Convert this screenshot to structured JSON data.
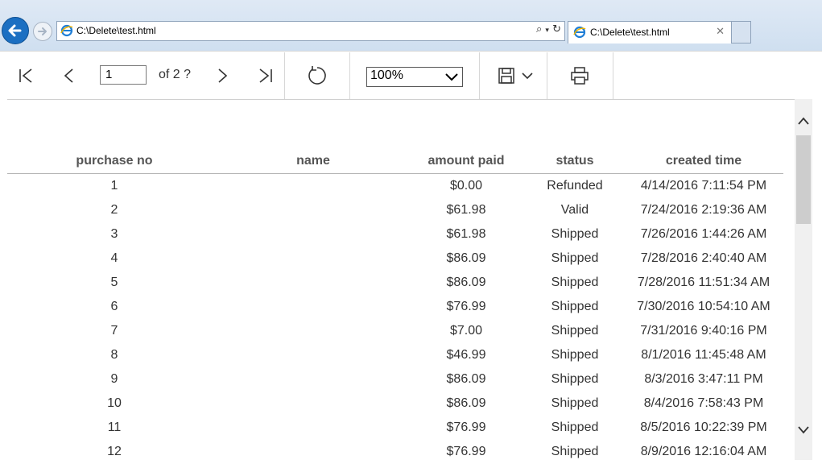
{
  "browser": {
    "address": "C:\\Delete\\test.html",
    "tab_title": "C:\\Delete\\test.html"
  },
  "toolbar": {
    "page_value": "1",
    "of_label": "of  2 ?",
    "zoom_value": "100%"
  },
  "table": {
    "headers": {
      "purchase_no": "purchase no",
      "name": "name",
      "amount_paid": "amount paid",
      "status": "status",
      "created_time": "created time"
    },
    "rows": [
      {
        "no": "1",
        "name": "",
        "amount": "$0.00",
        "status": "Refunded",
        "created": "4/14/2016 7:11:54 PM"
      },
      {
        "no": "2",
        "name": "",
        "amount": "$61.98",
        "status": "Valid",
        "created": "7/24/2016 2:19:36 AM"
      },
      {
        "no": "3",
        "name": "",
        "amount": "$61.98",
        "status": "Shipped",
        "created": "7/26/2016 1:44:26 AM"
      },
      {
        "no": "4",
        "name": "",
        "amount": "$86.09",
        "status": "Shipped",
        "created": "7/28/2016 2:40:40 AM"
      },
      {
        "no": "5",
        "name": "",
        "amount": "$86.09",
        "status": "Shipped",
        "created": "7/28/2016 11:51:34 AM"
      },
      {
        "no": "6",
        "name": "",
        "amount": "$76.99",
        "status": "Shipped",
        "created": "7/30/2016 10:54:10 AM"
      },
      {
        "no": "7",
        "name": "",
        "amount": "$7.00",
        "status": "Shipped",
        "created": "7/31/2016 9:40:16 PM"
      },
      {
        "no": "8",
        "name": "",
        "amount": "$46.99",
        "status": "Shipped",
        "created": "8/1/2016 11:45:48 AM"
      },
      {
        "no": "9",
        "name": "",
        "amount": "$86.09",
        "status": "Shipped",
        "created": "8/3/2016 3:47:11 PM"
      },
      {
        "no": "10",
        "name": "",
        "amount": "$86.09",
        "status": "Shipped",
        "created": "8/4/2016 7:58:43 PM"
      },
      {
        "no": "11",
        "name": "",
        "amount": "$76.99",
        "status": "Shipped",
        "created": "8/5/2016 10:22:39 PM"
      },
      {
        "no": "12",
        "name": "",
        "amount": "$76.99",
        "status": "Shipped",
        "created": "8/9/2016 12:16:04 AM"
      }
    ]
  }
}
